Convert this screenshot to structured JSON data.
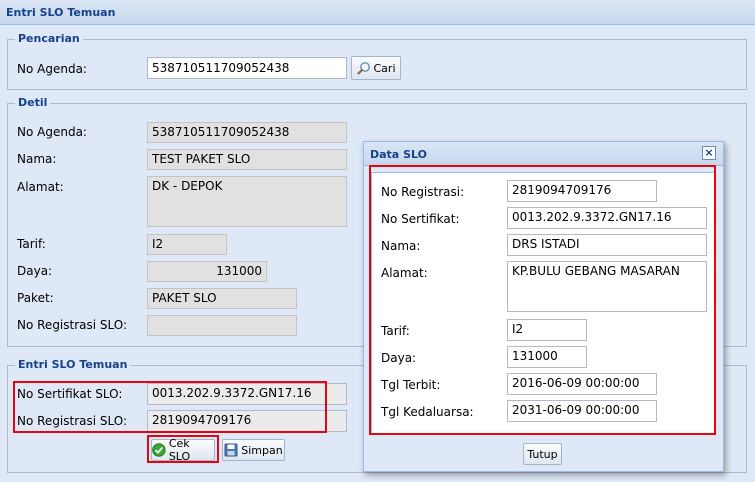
{
  "window": {
    "title": "Entri SLO Temuan"
  },
  "pencarian": {
    "legend": "Pencarian",
    "no_agenda_label": "No Agenda:",
    "no_agenda_value": "538710511709052438",
    "cari_label": "Cari"
  },
  "detil": {
    "legend": "Detil",
    "no_agenda_label": "No Agenda:",
    "no_agenda_value": "538710511709052438",
    "nama_label": "Nama:",
    "nama_value": "TEST PAKET SLO",
    "alamat_label": "Alamat:",
    "alamat_value": "DK - DEPOK",
    "tarif_label": "Tarif:",
    "tarif_value": "I2",
    "daya_label": "Daya:",
    "daya_value": "131000",
    "paket_label": "Paket:",
    "paket_value": "PAKET SLO",
    "no_registrasi_label": "No Registrasi SLO:",
    "no_registrasi_value": ""
  },
  "entri": {
    "legend": "Entri SLO Temuan",
    "no_sertifikat_label": "No Sertifikat SLO:",
    "no_sertifikat_value": "0013.202.9.3372.GN17.16",
    "no_registrasi_label": "No Registrasi SLO:",
    "no_registrasi_value": "2819094709176",
    "cek_label": "Cek SLO",
    "simpan_label": "Simpan"
  },
  "dialog": {
    "title": "Data SLO",
    "close_symbol": "×",
    "no_registrasi_label": "No Registrasi:",
    "no_registrasi_value": "2819094709176",
    "no_sertifikat_label": "No Sertifikat:",
    "no_sertifikat_value": "0013.202.9.3372.GN17.16",
    "nama_label": "Nama:",
    "nama_value": "DRS ISTADI",
    "alamat_label": "Alamat:",
    "alamat_value": "KP.BULU GEBANG MASARAN",
    "tarif_label": "Tarif:",
    "tarif_value": "I2",
    "daya_label": "Daya:",
    "daya_value": "131000",
    "tgl_terbit_label": "Tgl Terbit:",
    "tgl_terbit_value": "2016-06-09 00:00:00",
    "tgl_kedaluarsa_label": "Tgl Kedaluarsa:",
    "tgl_kedaluarsa_value": "2031-06-09 00:00:00",
    "tutup_label": "Tutup"
  },
  "colors": {
    "highlight": "#e3050f",
    "title_text": "#15428b",
    "panel_bg": "#dfe8f6"
  },
  "icons": {
    "search": "magnifier-icon",
    "check": "green-check-icon",
    "save": "floppy-disk-icon",
    "close": "close-icon"
  }
}
